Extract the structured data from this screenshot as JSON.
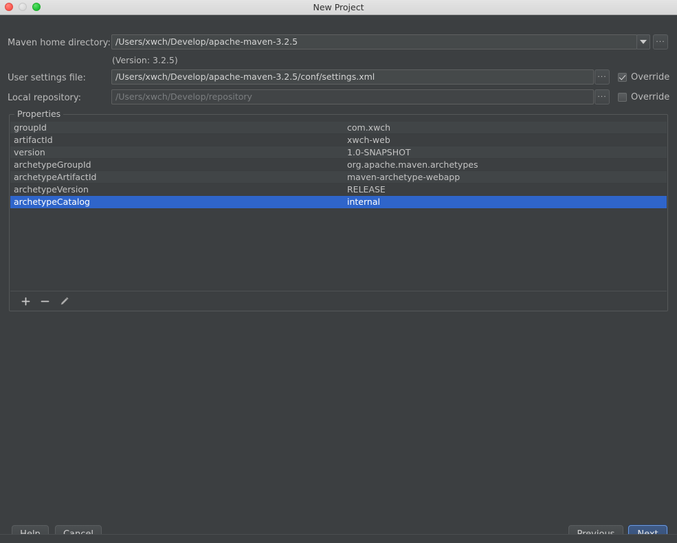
{
  "window": {
    "title": "New Project",
    "controls": {
      "close": "close-button",
      "minimize": "minimize-button",
      "zoom": "zoom-button"
    }
  },
  "form": {
    "maven_home": {
      "label": "Maven home directory:",
      "value": "/Users/xwch/Develop/apache-maven-3.2.5",
      "dropdown_icon": "chevron-down-icon",
      "browse_label": "...",
      "version_note": "(Version: 3.2.5)"
    },
    "user_settings": {
      "label": "User settings file:",
      "value": "/Users/xwch/Develop/apache-maven-3.2.5/conf/settings.xml",
      "browse_label": "...",
      "override_label": "Override",
      "override_checked": true
    },
    "local_repository": {
      "label": "Local repository:",
      "value": "/Users/xwch/Develop/repository",
      "browse_label": "...",
      "override_label": "Override",
      "override_checked": false
    }
  },
  "properties_panel": {
    "title": "Properties",
    "rows": [
      {
        "key": "groupId",
        "value": "com.xwch"
      },
      {
        "key": "artifactId",
        "value": "xwch-web"
      },
      {
        "key": "version",
        "value": "1.0-SNAPSHOT"
      },
      {
        "key": "archetypeGroupId",
        "value": "org.apache.maven.archetypes"
      },
      {
        "key": "archetypeArtifactId",
        "value": "maven-archetype-webapp"
      },
      {
        "key": "archetypeVersion",
        "value": "RELEASE"
      },
      {
        "key": "archetypeCatalog",
        "value": "internal"
      }
    ],
    "selected_row_index": 6,
    "toolbar": {
      "add": "plus-icon",
      "remove": "minus-icon",
      "edit": "pencil-icon"
    }
  },
  "footer": {
    "help_label": "Help",
    "cancel_label": "Cancel",
    "previous_label": "Previous",
    "next_label": "Next"
  },
  "colors": {
    "background": "#3c3f41",
    "selection_blue": "#2f65ca",
    "field_background": "#45494a",
    "text": "#bbbbbb",
    "titlebar": "#dedede",
    "primary_button": "#3f5a85",
    "primary_button_border": "#6d9be0"
  }
}
